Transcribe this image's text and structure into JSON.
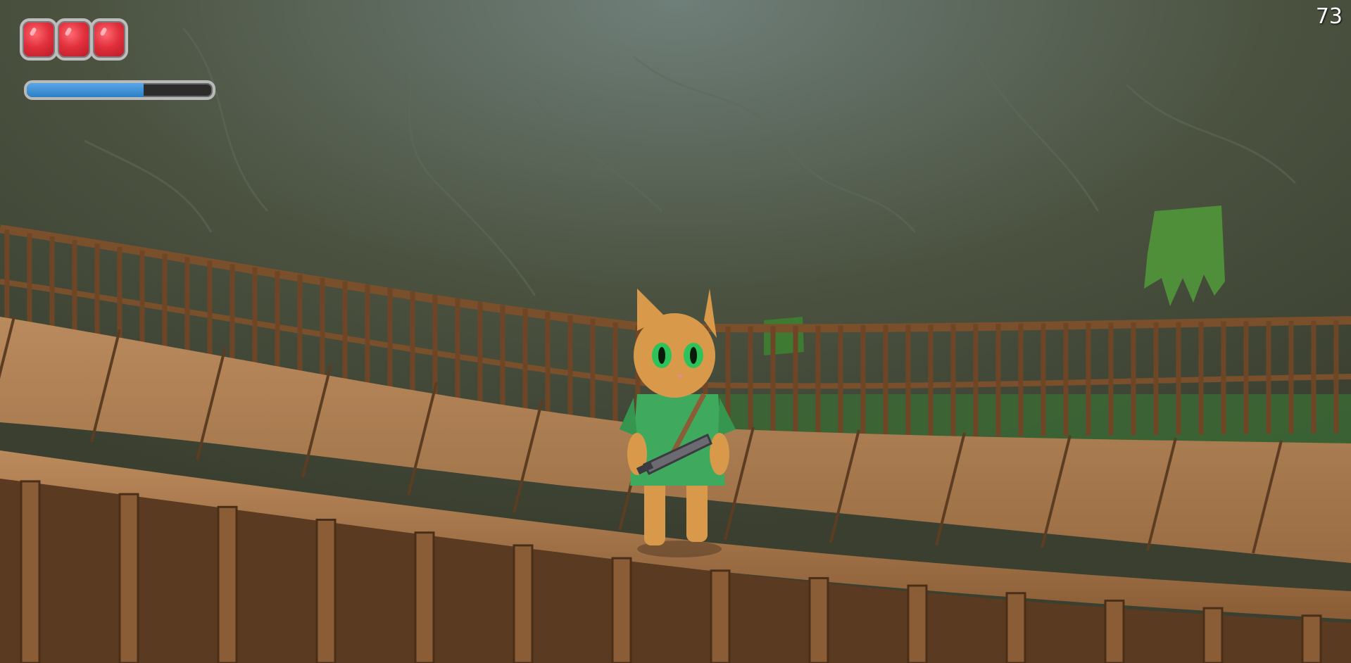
{
  "hud": {
    "hearts": [
      {
        "state": "full"
      },
      {
        "state": "full"
      },
      {
        "state": "full"
      }
    ],
    "stamina_fraction": 0.63,
    "fps_counter": "73"
  },
  "colors": {
    "heart": "#e0303c",
    "stamina": "#3a8fd6",
    "wood": "#a8764a",
    "cliff": "#4a5038",
    "cat_fur": "#d89a4a",
    "tunic": "#3faa5e"
  },
  "scene": {
    "character": "cat-adventurer",
    "held_item": "sword",
    "setting": "wooden-bridge"
  }
}
